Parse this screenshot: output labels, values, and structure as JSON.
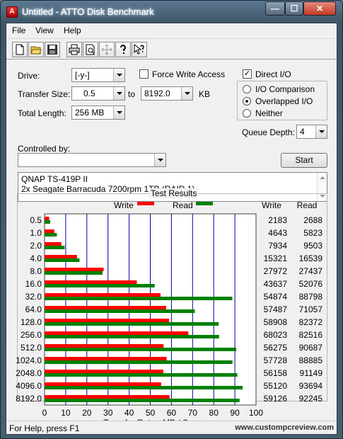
{
  "window": {
    "title": "Untitled - ATTO Disk Benchmark",
    "icon_letter": "A"
  },
  "window_buttons": {
    "minimize": "—",
    "maximize": "☐",
    "close": "✕"
  },
  "menu": [
    "File",
    "View",
    "Help"
  ],
  "toolbar": [
    "new-icon",
    "open-icon",
    "save-icon",
    "print-icon",
    "print-preview-icon",
    "move-icon",
    "help-icon",
    "context-help-icon"
  ],
  "drive": {
    "label": "Drive:",
    "value": "[-y-]"
  },
  "force_write": {
    "label": "Force Write Access",
    "checked": false
  },
  "direct_io": {
    "label": "Direct I/O",
    "checked": true
  },
  "transfer_size": {
    "label": "Transfer Size:",
    "from": "0.5",
    "to_label": "to",
    "to": "8192.0",
    "unit": "KB"
  },
  "total_length": {
    "label": "Total Length:",
    "value": "256 MB"
  },
  "io_mode": {
    "options": [
      "I/O Comparison",
      "Overlapped I/O",
      "Neither"
    ],
    "selected": "Overlapped I/O"
  },
  "queue_depth": {
    "label": "Queue Depth:",
    "value": "4"
  },
  "controlled_by": {
    "label": "Controlled by:",
    "value": ""
  },
  "start_button": "Start",
  "description": [
    "QNAP TS-419P II",
    "2x Seagate Barracuda 7200rpm 1TB (RAID 1)"
  ],
  "results_title": "Test Results",
  "status_text": "For Help, press F1",
  "site_text": "www.custompcreview.com",
  "colors": {
    "write": "#ff0000",
    "read": "#008000",
    "grid": "#0000a0"
  },
  "chart_data": {
    "type": "bar",
    "orientation": "horizontal",
    "xlabel": "Transfer Rate - MB / Sec",
    "xlim": [
      0,
      100
    ],
    "xticks": [
      0,
      10,
      20,
      30,
      40,
      50,
      60,
      70,
      80,
      90,
      100
    ],
    "legend": {
      "placement": "top",
      "write_label": "Write",
      "read_label": "Read"
    },
    "columns": {
      "write": "Write",
      "read": "Read"
    },
    "categories": [
      "0.5",
      "1.0",
      "2.0",
      "4.0",
      "8.0",
      "16.0",
      "32.0",
      "64.0",
      "128.0",
      "256.0",
      "512.0",
      "1024.0",
      "2048.0",
      "4096.0",
      "8192.0"
    ],
    "series": [
      {
        "name": "Write",
        "values": [
          2183,
          4643,
          7934,
          15321,
          27972,
          43637,
          54874,
          57487,
          58908,
          68023,
          56275,
          57728,
          56158,
          55120,
          59126
        ]
      },
      {
        "name": "Read",
        "values": [
          2688,
          5823,
          9503,
          16539,
          27437,
          52076,
          88798,
          71057,
          82372,
          82516,
          90687,
          88885,
          91149,
          93694,
          92245
        ]
      }
    ],
    "value_unit_note": "KB/s"
  }
}
